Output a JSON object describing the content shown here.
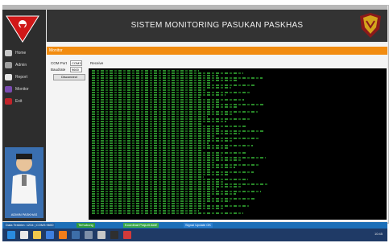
{
  "header": {
    "title": "SISTEM MONITORING PASUKAN PASKHAS"
  },
  "sidebar": {
    "items": [
      {
        "label": "Home"
      },
      {
        "label": "Admin"
      },
      {
        "label": "Report"
      },
      {
        "label": "Monitor"
      },
      {
        "label": "Exit"
      }
    ],
    "profile_caption": "ADMIN PASKHAS"
  },
  "panel": {
    "title": "Monitor",
    "com_label": "COM Port",
    "com_value": "COM3",
    "baud_label": "Baudrate",
    "baud_value": "9600",
    "connect_label": "Disconnect",
    "data_label": "Receive"
  },
  "statusbar": {
    "seg1": "Data Terkirim: 1234 | COM3 9600",
    "seg2": "Terhubung",
    "seg3": "Koordinat Prajurit Aktif",
    "seg4": "Signal Update OK"
  },
  "tray": {
    "time": "10:45"
  },
  "colors": {
    "accent": "#f28c10",
    "console_text": "#2f9a2f",
    "brand_red": "#d01818"
  }
}
